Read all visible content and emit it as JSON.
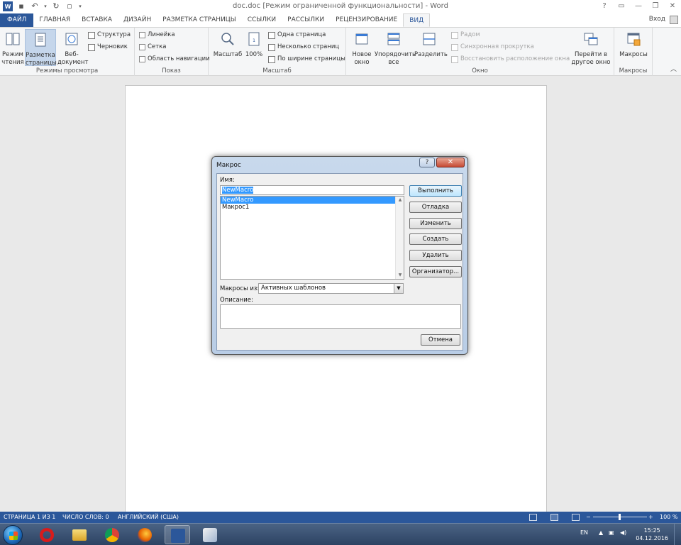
{
  "titlebar": {
    "title": "doc.doc [Режим ограниченной функциональности] - Word",
    "logo": "W",
    "controls": [
      "?",
      "▭",
      "—",
      "❐",
      "✕"
    ]
  },
  "tabs": [
    {
      "label": "ФАЙЛ"
    },
    {
      "label": "ГЛАВНАЯ"
    },
    {
      "label": "ВСТАВКА"
    },
    {
      "label": "ДИЗАЙН"
    },
    {
      "label": "РАЗМЕТКА СТРАНИЦЫ"
    },
    {
      "label": "ССЫЛКИ"
    },
    {
      "label": "РАССЫЛКИ"
    },
    {
      "label": "РЕЦЕНЗИРОВАНИЕ"
    },
    {
      "label": "ВИД"
    }
  ],
  "signin": "Вход",
  "ribbon": {
    "views": {
      "label": "Режимы просмотра",
      "read_mode": "Режим чтения",
      "print_layout": "Разметка страницы",
      "web_layout": "Веб-документ",
      "outline": "Структура",
      "draft": "Черновик"
    },
    "show": {
      "label": "Показ",
      "ruler": "Линейка",
      "gridlines": "Сетка",
      "nav_pane": "Область навигации"
    },
    "zoom": {
      "label": "Масштаб",
      "zoom": "Масштаб",
      "hundred": "100%",
      "one_page": "Одна страница",
      "multiple_pages": "Несколько страниц",
      "page_width": "По ширине страницы"
    },
    "window": {
      "label": "Окно",
      "new_window": "Новое окно",
      "arrange_all": "Упорядочить все",
      "split": "Разделить",
      "side_by_side": "Радом",
      "sync_scroll": "Синхронная прокрутка",
      "reset_position": "Восстановить расположение окна",
      "switch_windows": "Перейти в другое окно"
    },
    "macros": {
      "label": "Макросы",
      "macros": "Макросы"
    }
  },
  "dialog": {
    "title": "Макрос",
    "help": "?",
    "close": "✕",
    "name_label": "Имя:",
    "name_value": "NewMacro",
    "macros": [
      "NewMacro",
      "Макрос1"
    ],
    "selected_index": 0,
    "buttons": {
      "run": "Выполнить",
      "step": "Отладка",
      "edit": "Изменить",
      "create": "Создать",
      "delete": "Удалить",
      "organizer": "Организатор..."
    },
    "macros_in_label": "Макросы из:",
    "macros_in_value": "Активных шаблонов",
    "description_label": "Описание:",
    "cancel": "Отмена"
  },
  "statusbar": {
    "page": "СТРАНИЦА 1 ИЗ 1",
    "words": "ЧИСЛО СЛОВ: 0",
    "language": "АНГЛИЙСКИЙ (США)",
    "zoom": "100 %",
    "zoom_minus": "−",
    "zoom_plus": "+"
  },
  "taskbar": {
    "lang": "EN",
    "time": "15:25",
    "date": "04.12.2016"
  },
  "colors": {
    "accent": "#2b579a",
    "selection": "#3399ff"
  }
}
